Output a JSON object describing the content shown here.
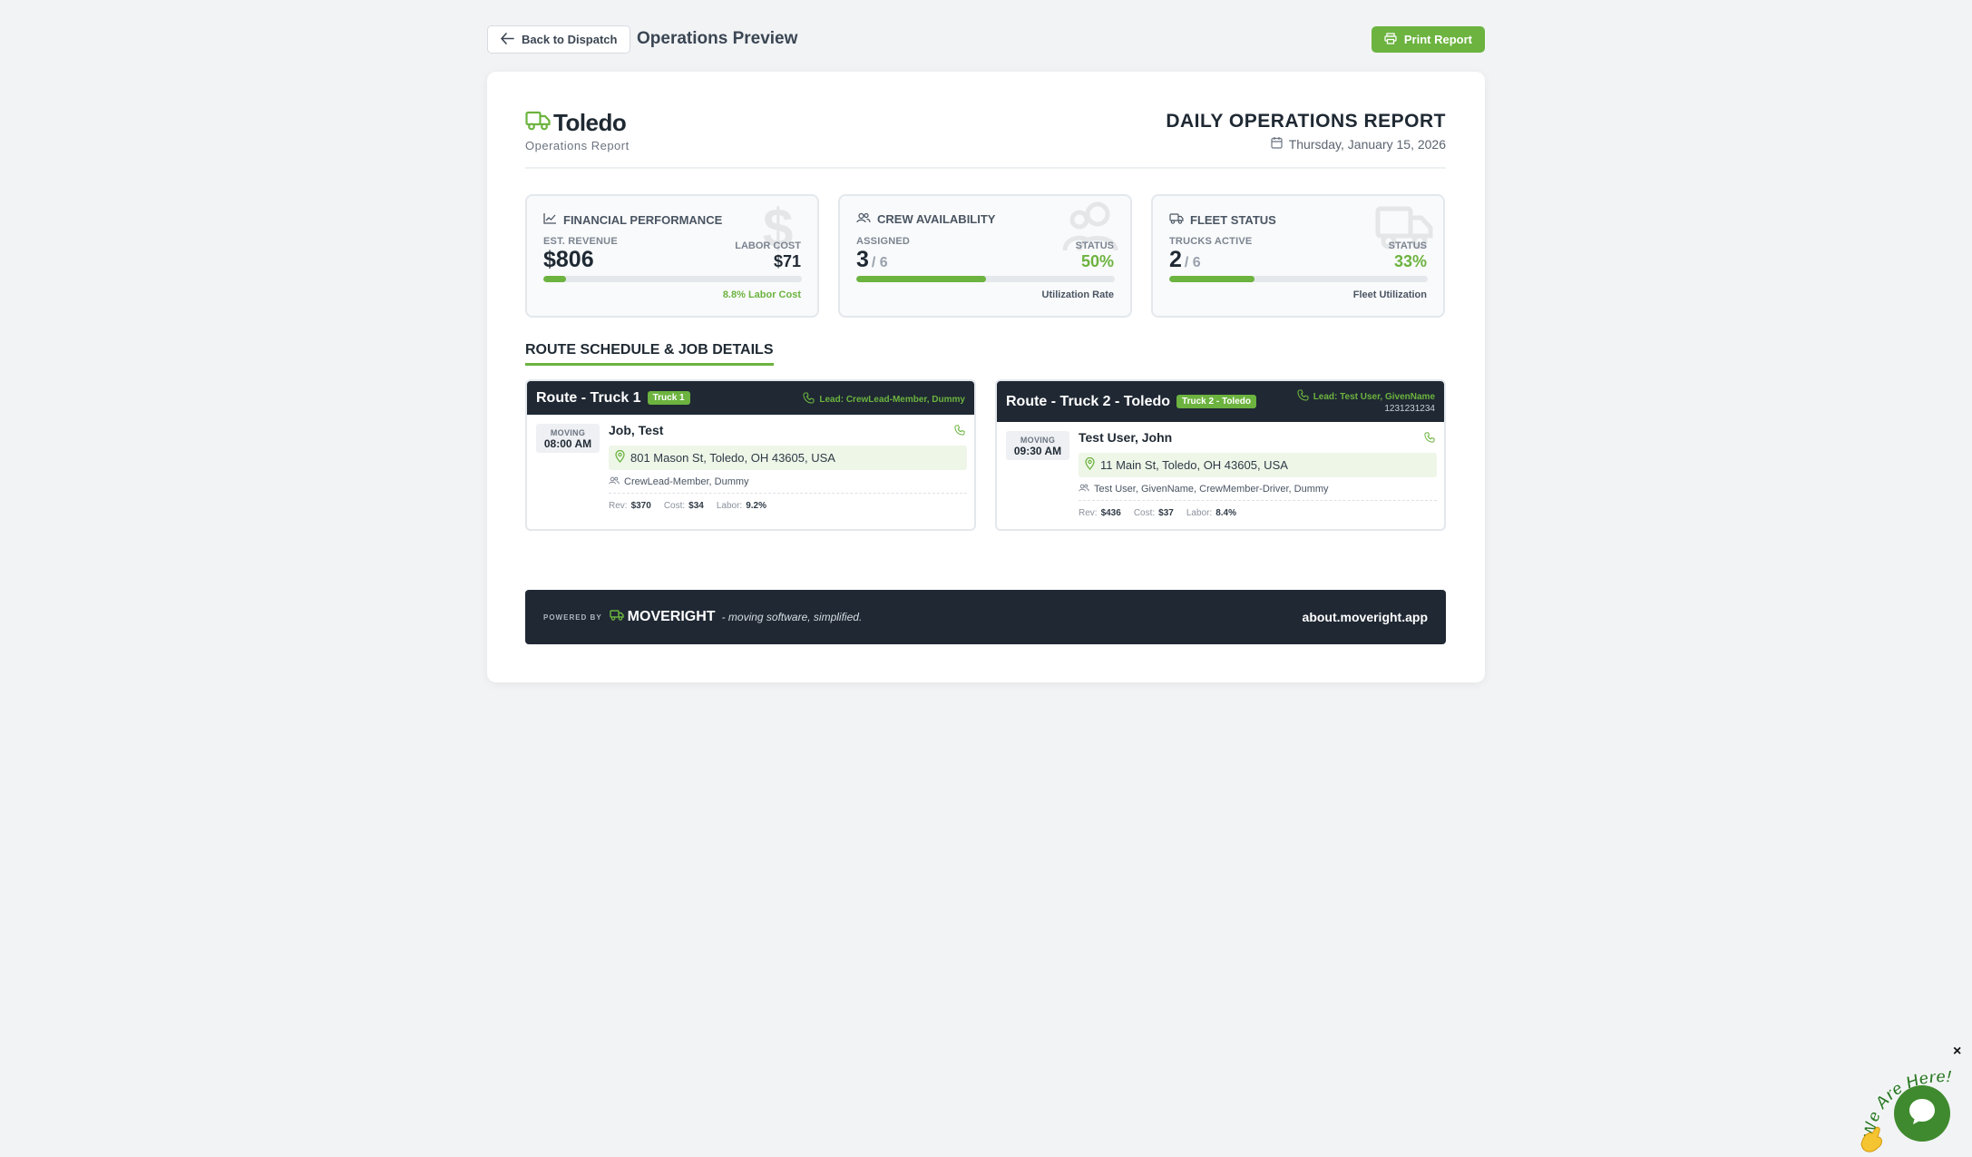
{
  "topbar": {
    "back_label": "Back to Dispatch",
    "page_title": "Operations Preview",
    "print_label": "Print Report"
  },
  "header": {
    "company": "Toledo",
    "subtitle": "Operations Report",
    "report_title": "DAILY OPERATIONS REPORT",
    "date": "Thursday, January 15, 2026"
  },
  "stats": {
    "financial": {
      "title": "FINANCIAL PERFORMANCE",
      "label": "EST. REVENUE",
      "value": "$806",
      "right_label": "LABOR COST",
      "right_value": "$71",
      "progress": 0.088,
      "footer": "8.8% Labor Cost"
    },
    "crew": {
      "title": "CREW AVAILABILITY",
      "label": "ASSIGNED",
      "value": "3",
      "of": "/ 6",
      "right_label": "STATUS",
      "right_value": "50%",
      "progress": 0.5,
      "footer": "Utilization Rate"
    },
    "fleet": {
      "title": "FLEET STATUS",
      "label": "TRUCKS ACTIVE",
      "value": "2",
      "of": "/ 6",
      "right_label": "STATUS",
      "right_value": "33%",
      "progress": 0.33,
      "footer": "Fleet Utilization"
    }
  },
  "section_title": "ROUTE SCHEDULE & JOB DETAILS",
  "routes": [
    {
      "name": "Route - Truck 1",
      "badge": "Truck 1",
      "lead": "Lead: CrewLead-Member, Dummy",
      "lead_phone": "",
      "job": {
        "type": "MOVING",
        "time": "08:00 AM",
        "customer": "Job, Test",
        "address": "801 Mason St, Toledo, OH 43605, USA",
        "crew": "CrewLead-Member, Dummy",
        "rev_label": "Rev:",
        "rev": "$370",
        "cost_label": "Cost:",
        "cost": "$34",
        "labor_label": "Labor:",
        "labor": "9.2%"
      }
    },
    {
      "name": "Route - Truck 2 - Toledo",
      "badge": "Truck 2 - Toledo",
      "lead": "Lead: Test User, GivenName",
      "lead_phone": "1231231234",
      "job": {
        "type": "MOVING",
        "time": "09:30 AM",
        "customer": "Test User, John",
        "address": "11 Main St, Toledo, OH 43605, USA",
        "crew": "Test User, GivenName, CrewMember-Driver, Dummy",
        "rev_label": "Rev:",
        "rev": "$436",
        "cost_label": "Cost:",
        "cost": "$37",
        "labor_label": "Labor:",
        "labor": "8.4%"
      }
    }
  ],
  "footer": {
    "powered_by": "POWERED BY",
    "brand": "MOVERIGHT",
    "tagline": "- moving software, simplified.",
    "site": "about.moveright.app"
  },
  "chat": {
    "badge_text": "We Are Here!",
    "close": "×"
  },
  "colors": {
    "accent": "#6cb33f",
    "dark": "#1f2833",
    "background": "#f1f3f5"
  }
}
